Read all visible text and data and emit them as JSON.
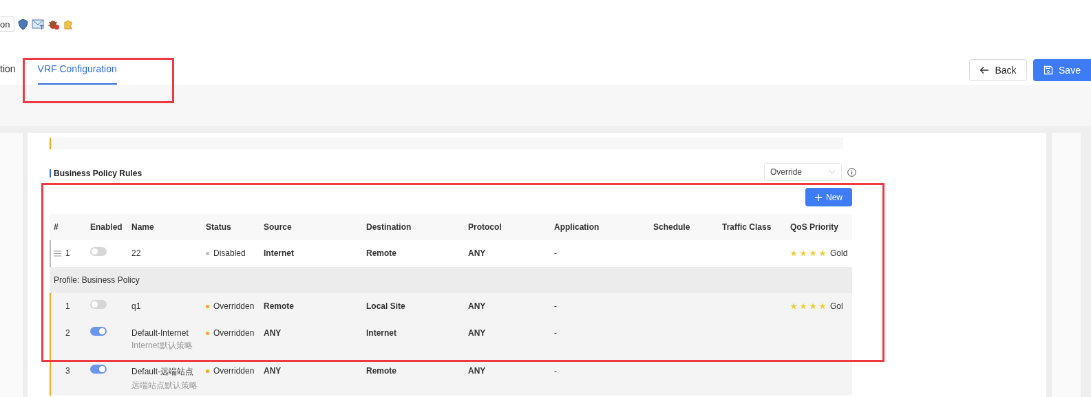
{
  "toolbar": {
    "button_label": "on"
  },
  "tabs": [
    {
      "label": "tion",
      "selected": false
    },
    {
      "label": "VRF Configuration",
      "selected": true
    }
  ],
  "actions": {
    "back": "Back",
    "save": "Save"
  },
  "section": {
    "title": "Business Policy Rules",
    "mode_select": {
      "value": "Override"
    },
    "new_button": "New"
  },
  "table": {
    "columns": [
      "#",
      "Enabled",
      "Name",
      "Status",
      "Source",
      "Destination",
      "Protocol",
      "Application",
      "Schedule",
      "Traffic Class",
      "QoS Priority"
    ],
    "rows": [
      {
        "index": "1",
        "draggable": true,
        "enabled": false,
        "name": "22",
        "status": "Disabled",
        "color": "#bfbfbf",
        "source": "Internet",
        "destination": "Remote",
        "protocol": "ANY",
        "application": "-",
        "stars": 4,
        "qos": "Gold"
      }
    ],
    "group": {
      "title": "Profile: Business Policy",
      "rows": [
        {
          "index": "1",
          "enabled": false,
          "name": "q1",
          "status": "Overridden",
          "color": "#f5a623",
          "source": "Remote",
          "destination": "Local Site",
          "protocol": "ANY",
          "application": "-",
          "stars": 4,
          "qos": "Gol"
        },
        {
          "index": "2",
          "enabled": true,
          "name": "Default-Internet",
          "subtitle": "Internet默认策略",
          "status": "Overridden",
          "color": "#f5a623",
          "source": "ANY",
          "destination": "Internet",
          "protocol": "ANY",
          "application": "-"
        },
        {
          "index": "3",
          "enabled": true,
          "name": "Default-远端站点",
          "subtitle": "远端站点默认策略",
          "status": "Overridden",
          "color": "#f5a623",
          "source": "ANY",
          "destination": "Remote",
          "protocol": "ANY",
          "application": "-"
        }
      ]
    }
  }
}
